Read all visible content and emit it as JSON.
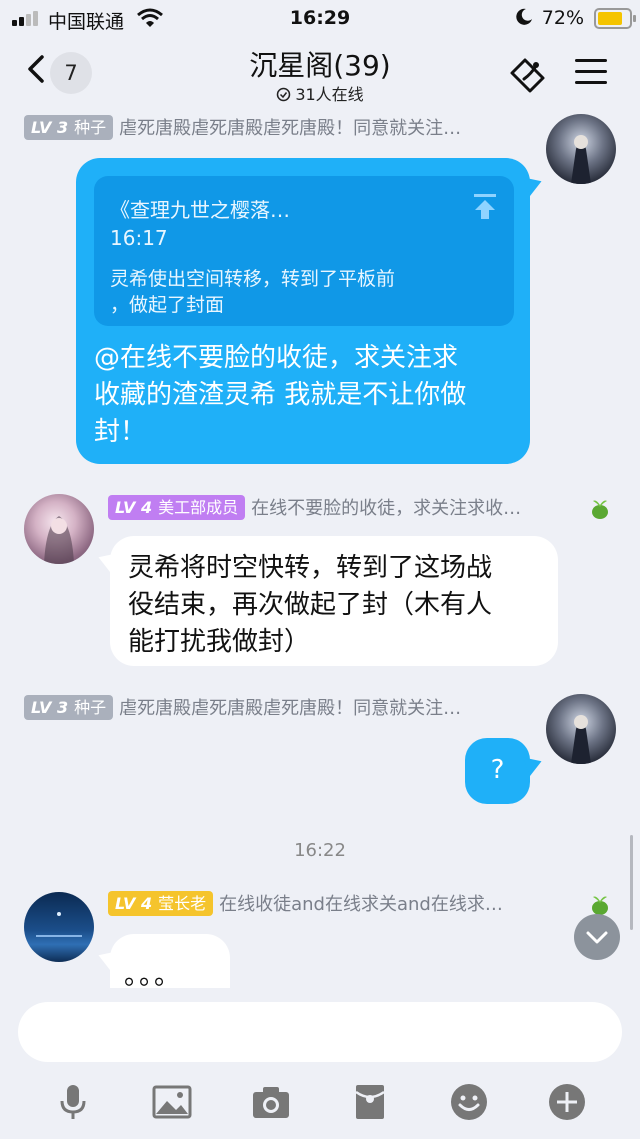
{
  "status_bar": {
    "carrier": "中国联通",
    "time": "16:29",
    "battery_percent": "72%"
  },
  "header": {
    "back_count": "7",
    "title": "沉星阁(39)",
    "online": "31人在线"
  },
  "messages": [
    {
      "level": "LV 3",
      "title": "种子",
      "title_color": "#aab0bc",
      "name": "虐死唐殿虐死唐殿虐死唐殿！同意就关注…",
      "side": "right",
      "quote": {
        "title": "《查理九世之樱落…",
        "time": "16:17",
        "line1": "灵希使出空间转移，转到了平板前",
        "line2": "，做起了封面"
      },
      "text_lines": [
        "@在线不要脸的收徒，求关注求",
        "收藏的渣渣灵希 我就是不让你做",
        "封！"
      ]
    },
    {
      "level": "LV 4",
      "title": "美工部成员",
      "title_color": "#c07ef2",
      "name": "在线不要脸的收徒，求关注求收…",
      "side": "left",
      "text_lines": [
        "灵希将时空快转，转到了这场战",
        "役结束，再次做起了封（木有人",
        "能打扰我做封）"
      ]
    },
    {
      "level": "LV 3",
      "title": "种子",
      "title_color": "#aab0bc",
      "name": "虐死唐殿虐死唐殿虐死唐殿！同意就关注…",
      "side": "right",
      "text_lines": [
        "?"
      ]
    },
    {
      "level": "LV 4",
      "title": "莹长老",
      "title_color": "#f5c42c",
      "name": "在线收徒and在线求关and在线求…",
      "side": "left",
      "text_lines": [
        "。。。"
      ]
    }
  ],
  "timestamp": "16:22",
  "input": {
    "placeholder": ""
  },
  "colors": {
    "bubble_blue": "#1fb0f8",
    "quote_blue": "#1098e7",
    "background": "#eef0f6"
  }
}
